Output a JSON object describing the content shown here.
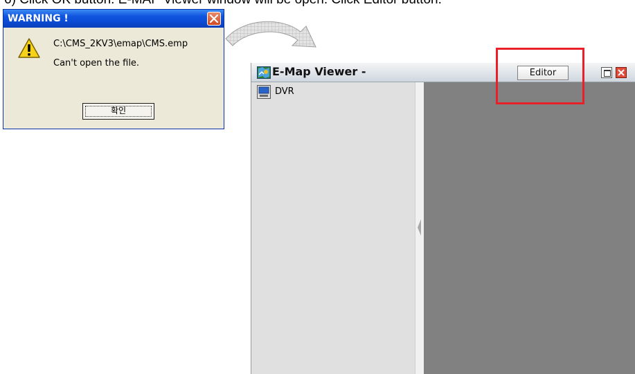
{
  "instruction": "6) Click OK button. E-MAP Viewer window will be open. Click Editor button.",
  "warning_dialog": {
    "title": "WARNING !",
    "path": "C:\\CMS_2KV3\\emap\\CMS.emp",
    "message": "Can't open the file.",
    "ok_label": "확인",
    "icon": "warning-icon",
    "close_icon": "close-icon"
  },
  "viewer": {
    "title": "E-Map Viewer  -",
    "editor_label": "Editor",
    "tree": [
      {
        "label": "DVR",
        "icon": "dvr-icon"
      }
    ],
    "colors": {
      "map_background": "#818181",
      "tree_background": "#e0e0e0",
      "highlight": "#e8202a"
    }
  }
}
